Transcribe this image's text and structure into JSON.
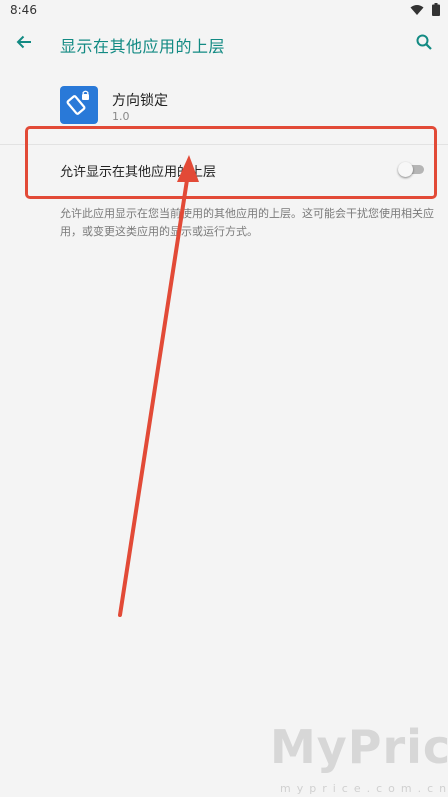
{
  "status_bar": {
    "time": "8:46"
  },
  "header": {
    "title": "显示在其他应用的上层"
  },
  "app": {
    "name": "方向锁定",
    "version": "1.0"
  },
  "setting": {
    "label": "允许显示在其他应用的上层",
    "enabled": false
  },
  "description": "允许此应用显示在您当前使用的其他应用的上层。这可能会干扰您使用相关应用，或变更这类应用的显示或运行方式。",
  "watermark": {
    "brand": "MyPrice",
    "domain": "myprice.com.cn"
  },
  "colors": {
    "accent": "#128a83",
    "annotation": "#e24a37",
    "app_icon": "#2979d8"
  }
}
